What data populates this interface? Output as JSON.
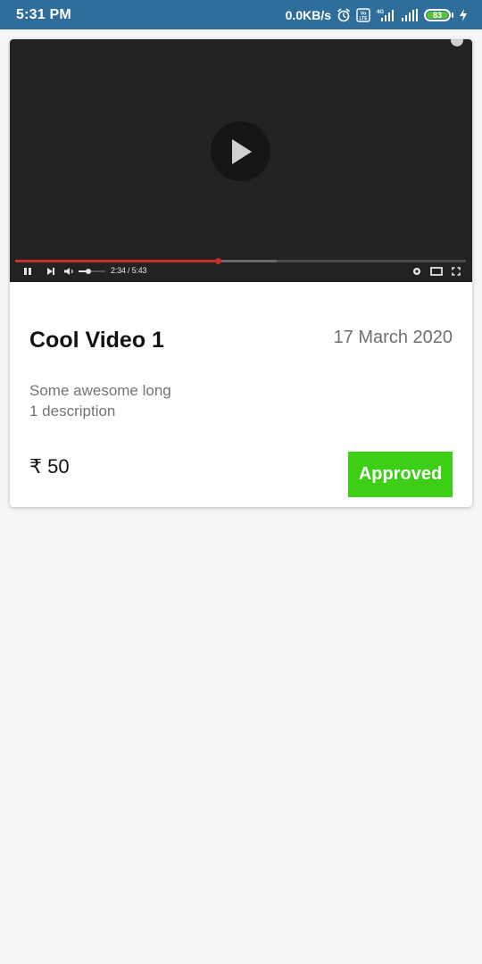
{
  "status_bar": {
    "time": "5:31 PM",
    "network_speed": "0.0KB/s",
    "network_type": "4G",
    "battery_level": "83",
    "icons": [
      "alarm-icon",
      "volte-icon",
      "signal-4g-icon",
      "signal-icon",
      "battery-icon",
      "charging-icon"
    ]
  },
  "video_card": {
    "player": {
      "time_readout": "2:34 / 5:43",
      "progress_fraction": 0.45,
      "buffered_fraction": 0.58,
      "controls": [
        "pause-icon",
        "next-icon",
        "volume-icon",
        "settings-icon",
        "theater-mode-icon",
        "fullscreen-icon"
      ]
    },
    "title": "Cool Video 1",
    "date": "17 March 2020",
    "description_lines": [
      "Some awesome long",
      "1 description"
    ],
    "price": "₹ 50",
    "status_label": "Approved",
    "colors": {
      "status_bar_bg": "#2f6d9a",
      "status_button_bg": "#3dcf16",
      "progress_played": "#c4302b",
      "player_bg": "#232122"
    }
  }
}
